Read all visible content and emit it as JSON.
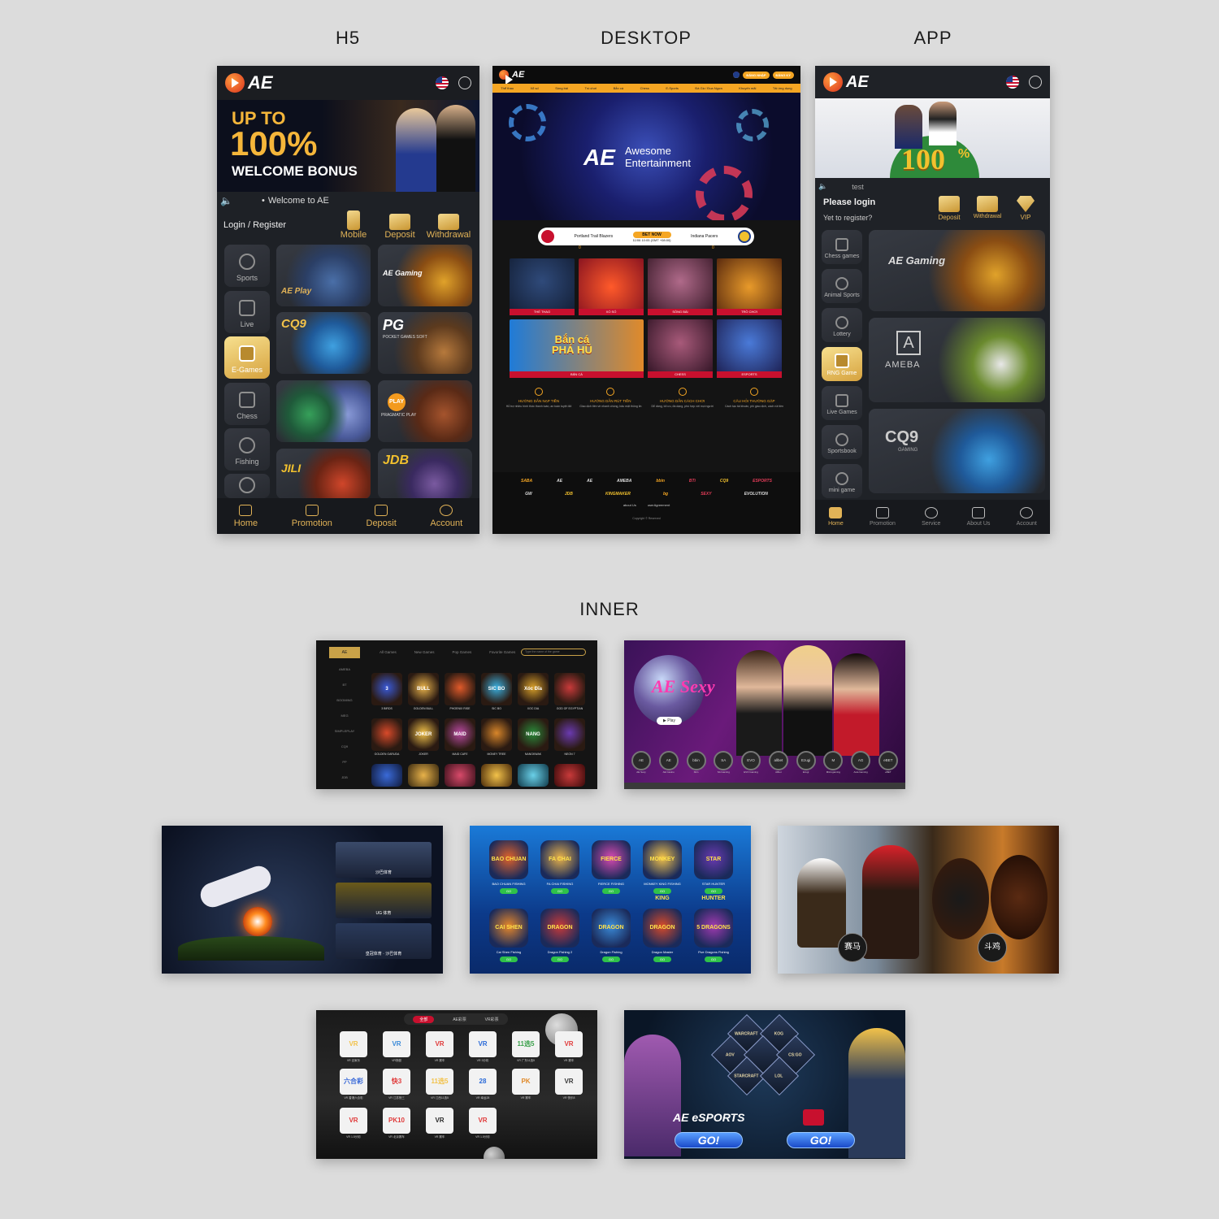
{
  "sections": {
    "h5": "H5",
    "desktop": "DESKTOP",
    "app": "APP",
    "inner": "INNER"
  },
  "h5": {
    "logo": "AE",
    "banner": {
      "line1": "UP TO",
      "line2": "100%",
      "line3": "WELCOME BONUS"
    },
    "marquee": "Welcome to AE",
    "login": "Login / Register",
    "actions": [
      "Mobile",
      "Deposit",
      "Withdrawal"
    ],
    "sidebar": [
      "Sports",
      "Live",
      "E-Games",
      "Chess",
      "Fishing"
    ],
    "tiles": [
      "AE Play",
      "AE Gaming",
      "CQ9",
      "PG",
      "",
      "PLAY",
      "JILI",
      "JDB"
    ],
    "tile_sub": {
      "pg": "POCKET GAMES SOFT",
      "pp": "PRAGMATIC PLAY"
    },
    "nav": [
      "Home",
      "Promotion",
      "Deposit",
      "Account"
    ]
  },
  "desktop": {
    "logo": "AE",
    "login_btn": "ĐĂNG NHẬP",
    "register_btn": "ĐĂNG KÝ",
    "menu": [
      "Thể thao",
      "Xổ số",
      "Sòng bài",
      "Trò chơi",
      "Bắn cá",
      "Chess",
      "E-Sports",
      "Đá Gà / Đua Ngựa",
      "Khuyến mãi",
      "Tải ứng dụng"
    ],
    "hero": {
      "line1": "Awesome",
      "line2": "Entertainment"
    },
    "match": {
      "home": "Portland Trail Blazers",
      "bet": "BET NOW",
      "away": "Indiana Pacers",
      "time": "11/06 10:05 (GMT +08:00)",
      "score_home": "0",
      "score_away": "0"
    },
    "cards_row1": [
      "THỂ THAO",
      "XỔ SỐ",
      "SÒNG BÀI",
      "TRÒ CHƠI"
    ],
    "cards_row2": [
      "BẮN CÁ",
      "CHESS",
      "ESPORTS"
    ],
    "fish_art": {
      "line1": "Bắn cá",
      "line2": "PHÁ HŨ"
    },
    "guides": [
      {
        "title": "HƯỚNG DẪN NẠP TIỀN",
        "desc": "Hỗ trợ nhiều hình thức thanh toán, an toàn tuyệt đối"
      },
      {
        "title": "HƯỚNG DẪN RÚT TIỀN",
        "desc": "Giao dịch tiền về nhanh chóng, bảo mật thông tin"
      },
      {
        "title": "HƯỚNG DẪN CÁCH CHƠI",
        "desc": "Dễ dàng, tối ưu, đa dạng, phù hợp với mọi người"
      },
      {
        "title": "CÂU HỎI THƯỜNG GẶP",
        "desc": "Cách tạo tài khoản, phí giao dịch, cách rút tiền"
      }
    ],
    "partners_row1": [
      "SABA",
      "AE",
      "AE",
      "AMEBA",
      "bbin",
      "BTi",
      "CQ9",
      "ESPORTS"
    ],
    "partners_row2": [
      "GW",
      "JDB",
      "KINGMAKER",
      "bg",
      "SEXY",
      "EVOLUTION"
    ],
    "footer_links": [
      "about Us",
      "userAgreement"
    ],
    "copyright": "Copyright © Reserved"
  },
  "app": {
    "logo": "AE",
    "marquee": "test",
    "please_login": "Please login",
    "yet_register": "Yet to register?",
    "actions": [
      "Deposit",
      "Withdrawal",
      "VIP"
    ],
    "sidebar": [
      "Chess games",
      "Animal Sports",
      "Lottery",
      "RNG Game",
      "Live Games",
      "Sportsbook",
      "mini game"
    ],
    "tiles": [
      "AE Gaming",
      "AMEBA",
      "CQ9"
    ],
    "tile_sub": {
      "cq9": "GAMING"
    },
    "banner": {
      "big": "100",
      "suffix": "%"
    },
    "nav": [
      "Home",
      "Promotion",
      "Service",
      "About Us",
      "Account"
    ]
  },
  "inner1": {
    "brand": "AE",
    "tabs": [
      "All Games",
      "New Games",
      "Pop Games",
      "Favorite Games"
    ],
    "search": "Type the name of the game",
    "providers": [
      "AMEBA",
      "BT",
      "BOOMING",
      "MEG",
      "SIMPLEPLAY",
      "CQ9",
      "PP",
      "JDB",
      "E.E.A"
    ],
    "games_row1": [
      "3 BIRDS",
      "GOLDEN BULL",
      "PHOENIX RISE",
      "SIC BO",
      "XOC DIA",
      "GOD OF EGYPTIAN"
    ],
    "games_row2": [
      "GOLDEN GARUDA",
      "JOKER",
      "MAID CAFE",
      "MONEY TREE",
      "NANGKWAK",
      "NEON 7"
    ],
    "art_row1": [
      "3",
      "BULL",
      "",
      "SIC BO",
      "Xóc Đĩa",
      ""
    ],
    "art_row2": [
      "",
      "JOKER",
      "MAID",
      "",
      "NANG",
      ""
    ]
  },
  "inner2": {
    "brand": "AE Sexy",
    "play": "▶ Play",
    "providers": [
      "AE Sexy",
      "AE Casino",
      "bbin",
      "SA Gaming",
      "EVO Gaming",
      "Allbet",
      "Ezugi",
      "Microgaming",
      "Asia Gaming",
      "eBET"
    ],
    "chips": [
      "AE",
      "AE",
      "bbin",
      "SA",
      "EVO",
      "allbet",
      "Ezugi",
      "M",
      "AG",
      "eBET"
    ]
  },
  "inner3": {
    "panels": [
      "沙巴体育",
      "UG 体育",
      "皇冠体育 · 沙巴体育"
    ]
  },
  "inner4": {
    "play_btn": "GO",
    "row1": [
      {
        "art": "BAO CHUAN",
        "label": "BAO CHUAN FISHING"
      },
      {
        "art": "FA CHAI",
        "label": "FA CHAI FISHING"
      },
      {
        "art": "FIERCE",
        "label": "FIERCE FISHING"
      },
      {
        "art": "MONKEY KING",
        "label": "MONKEY KING FISHING"
      },
      {
        "art": "STAR HUNTER",
        "label": "STAR HUNTER"
      }
    ],
    "row2": [
      {
        "art": "CAI SHEN",
        "label": "Cai Shen Fishing"
      },
      {
        "art": "DRAGON",
        "label": "Dragon Fishing 2"
      },
      {
        "art": "DRAGON",
        "label": "Dragon Fishing"
      },
      {
        "art": "DRAGON",
        "label": "Dragon Master"
      },
      {
        "art": "5 DRAGONS",
        "label": "Five Dragons Fishing"
      }
    ]
  },
  "inner5": {
    "left_badge": "赛马",
    "right_badge": "斗鸡"
  },
  "inner6": {
    "tabs": [
      "全部",
      "AE彩票",
      "VR彩票"
    ],
    "row1": [
      {
        "art": "VR",
        "label": "VR 百家乐"
      },
      {
        "art": "VR",
        "label": "VR快艇"
      },
      {
        "art": "VR",
        "label": "VR 赛车"
      },
      {
        "art": "VR",
        "label": "VR 3分彩"
      },
      {
        "art": "11选5",
        "label": "VR 广东11选5"
      },
      {
        "art": "VR",
        "label": "VR 赛车"
      }
    ],
    "row2": [
      {
        "art": "六合彩",
        "label": "VR 香港六合彩"
      },
      {
        "art": "快3",
        "label": "VR 江苏快三"
      },
      {
        "art": "11选5",
        "label": "VR 江西11选5"
      },
      {
        "art": "28",
        "label": "VR 幸运28"
      },
      {
        "art": "PK",
        "label": "VR 赛车"
      },
      {
        "art": "VR",
        "label": "VR 快乐8"
      }
    ],
    "row3": [
      {
        "art": "VR",
        "label": "VR 1.5分彩"
      },
      {
        "art": "PK10",
        "label": "VR 北京赛车"
      },
      {
        "art": "VR",
        "label": "VR 赛车"
      },
      {
        "art": "VR",
        "label": "VR 1.5分彩"
      }
    ]
  },
  "inner7": {
    "brand": "AE eSPORTS",
    "go1": "GO!",
    "go2": "GO!",
    "games": [
      "WARCRAFT",
      "KOG",
      "AOV",
      "",
      "CS:GO",
      "STARCRAFT",
      "LOL"
    ]
  },
  "colors": {
    "accent": "#e2b357",
    "bg": "#dcdcdc",
    "dark": "#1e2126",
    "orange": "#f5a623"
  }
}
